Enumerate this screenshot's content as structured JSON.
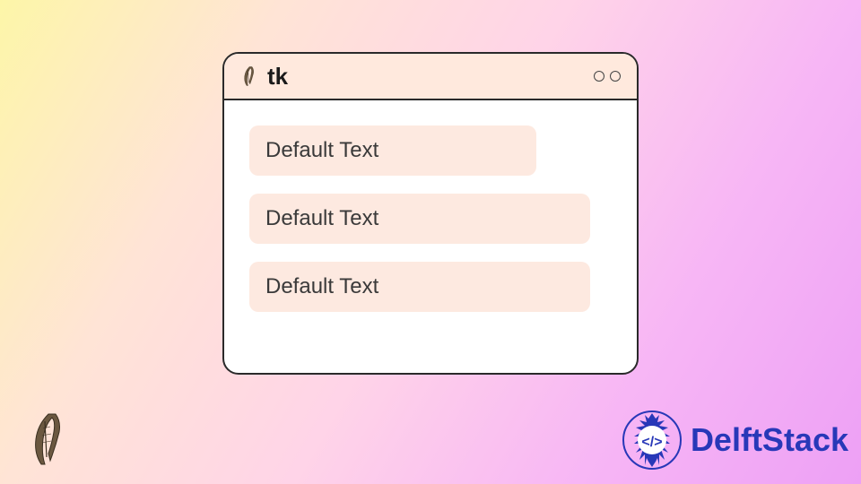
{
  "window": {
    "title": "tk",
    "icon": "feather-icon",
    "fields": [
      {
        "value": "Default Text"
      },
      {
        "value": "Default Text"
      },
      {
        "value": "Default Text"
      }
    ]
  },
  "branding": {
    "name": "DelftStack",
    "icon": "mandala-code-icon"
  },
  "decoration": {
    "feather": "feather-icon"
  }
}
